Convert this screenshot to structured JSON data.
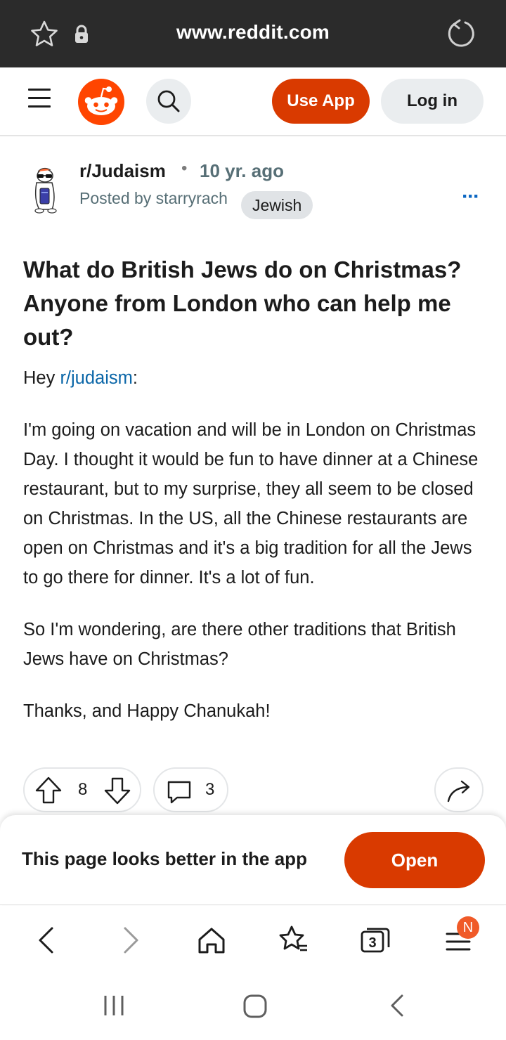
{
  "browser": {
    "url": "www.reddit.com",
    "icons": [
      "star-outline-icon",
      "lock-icon",
      "reload-icon"
    ]
  },
  "header": {
    "use_app_label": "Use App",
    "login_label": "Log in",
    "icons": [
      "hamburger-menu-icon",
      "reddit-logo-icon",
      "search-icon"
    ],
    "brand_color": "#ff4500",
    "button_color": "#d93a00"
  },
  "post": {
    "subreddit": "r/Judaism",
    "separator": "•",
    "age": "10 yr. ago",
    "posted_by": "Posted by starryrach",
    "flair": "Jewish",
    "more_label": "···",
    "title": "What do British Jews do on Christmas? Anyone from London who can help me out?",
    "greeting_prefix": "Hey ",
    "greeting_link": "r/judaism",
    "greeting_suffix": ":",
    "paragraph_1": "I'm going on vacation and will be in London on Christmas Day. I thought it would be fun to have dinner at a Chinese restaurant, but to my surprise, they all seem to be closed on Christmas. In the US, all the Chinese restaurants are open on Christmas and it's a big tradition for all the Jews to go there for dinner. It's a lot of fun.",
    "paragraph_2": "So I'm wondering, are there other traditions that British Jews have on Christmas?",
    "paragraph_3": "Thanks, and Happy Chanukah!",
    "link_color": "#0a66a8"
  },
  "actions": {
    "votes": "8",
    "comments": "3",
    "icons": [
      "upvote-icon",
      "downvote-icon",
      "comment-icon",
      "share-icon"
    ]
  },
  "app_banner": {
    "text": "This page looks better in the app",
    "open_label": "Open"
  },
  "browser_nav": {
    "tabs_count": "3",
    "menu_badge": "N",
    "icons": [
      "back-icon",
      "forward-icon",
      "home-icon",
      "bookmarks-icon",
      "tabs-icon",
      "menu-icon"
    ]
  },
  "system_nav": {
    "icons": [
      "recents-icon",
      "home-button-icon",
      "system-back-icon"
    ]
  }
}
